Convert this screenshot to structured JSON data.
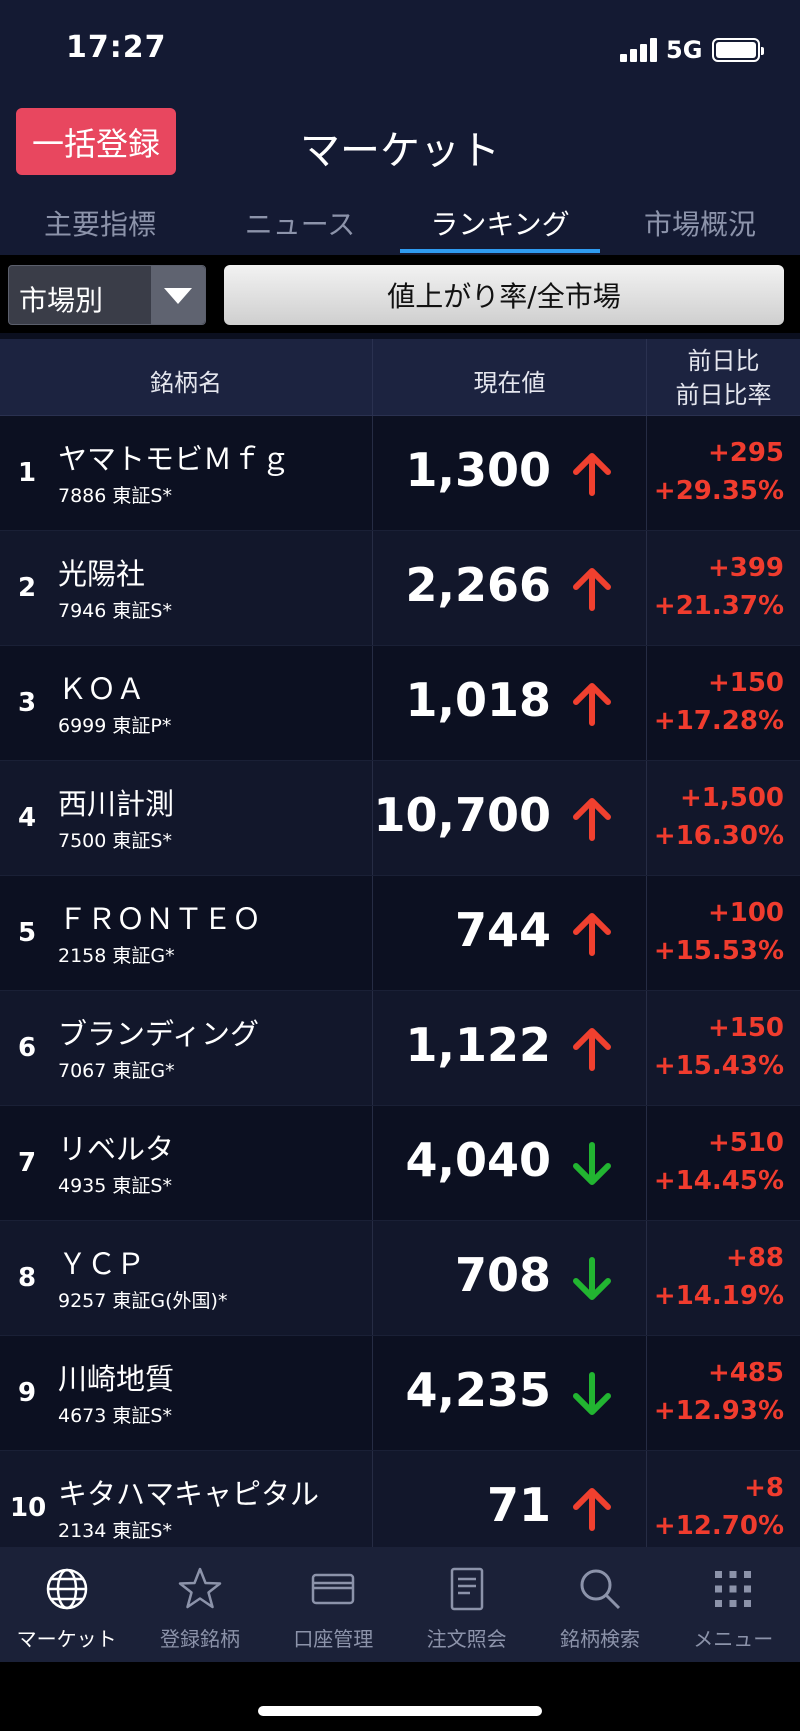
{
  "status_bar": {
    "time": "17:27",
    "network": "5G"
  },
  "header": {
    "bulk_register_label": "一括登録",
    "title": "マーケット",
    "tabs": [
      {
        "label": "主要指標",
        "active": false
      },
      {
        "label": "ニュース",
        "active": false
      },
      {
        "label": "ランキング",
        "active": true
      },
      {
        "label": "市場概況",
        "active": false
      }
    ]
  },
  "filter": {
    "market_select_value": "市場別",
    "ranking_type_label": "値上がり率/全市場"
  },
  "table": {
    "columns": {
      "name": "銘柄名",
      "price": "現在値",
      "change_line1": "前日比",
      "change_line2": "前日比率"
    },
    "rows": [
      {
        "rank": "1",
        "name": "ヤマトモビＭｆｇ",
        "code": "7886 東証S*",
        "price": "1,300",
        "direction": "up",
        "change": "+295",
        "change_pct": "+29.35%"
      },
      {
        "rank": "2",
        "name": "光陽社",
        "code": "7946 東証S*",
        "price": "2,266",
        "direction": "up",
        "change": "+399",
        "change_pct": "+21.37%"
      },
      {
        "rank": "3",
        "name": "ＫＯＡ",
        "code": "6999 東証P*",
        "price": "1,018",
        "direction": "up",
        "change": "+150",
        "change_pct": "+17.28%"
      },
      {
        "rank": "4",
        "name": "西川計測",
        "code": "7500 東証S*",
        "price": "10,700",
        "direction": "up",
        "change": "+1,500",
        "change_pct": "+16.30%"
      },
      {
        "rank": "5",
        "name": "ＦＲＯＮＴＥＯ",
        "code": "2158 東証G*",
        "price": "744",
        "direction": "up",
        "change": "+100",
        "change_pct": "+15.53%"
      },
      {
        "rank": "6",
        "name": "ブランディング",
        "code": "7067 東証G*",
        "price": "1,122",
        "direction": "up",
        "change": "+150",
        "change_pct": "+15.43%"
      },
      {
        "rank": "7",
        "name": "リベルタ",
        "code": "4935 東証S*",
        "price": "4,040",
        "direction": "down",
        "change": "+510",
        "change_pct": "+14.45%"
      },
      {
        "rank": "8",
        "name": "ＹＣＰ",
        "code": "9257 東証G(外国)*",
        "price": "708",
        "direction": "down",
        "change": "+88",
        "change_pct": "+14.19%"
      },
      {
        "rank": "9",
        "name": "川崎地質",
        "code": "4673 東証S*",
        "price": "4,235",
        "direction": "down",
        "change": "+485",
        "change_pct": "+12.93%"
      },
      {
        "rank": "10",
        "name": "キタハマキャピタル",
        "code": "2134 東証S*",
        "price": "71",
        "direction": "up",
        "change": "+8",
        "change_pct": "+12.70%"
      }
    ]
  },
  "colors": {
    "up_arrow": "#f0402f",
    "down_arrow": "#22b531",
    "change_text": "#f03c2e",
    "accent_tab": "#2f9bf0",
    "bulk_button": "#e8475f"
  },
  "bottom_nav": [
    {
      "label": "マーケット",
      "icon": "globe-icon",
      "active": true
    },
    {
      "label": "登録銘柄",
      "icon": "star-icon",
      "active": false
    },
    {
      "label": "口座管理",
      "icon": "card-icon",
      "active": false
    },
    {
      "label": "注文照会",
      "icon": "document-icon",
      "active": false
    },
    {
      "label": "銘柄検索",
      "icon": "search-icon",
      "active": false
    },
    {
      "label": "メニュー",
      "icon": "grid-menu-icon",
      "active": false
    }
  ]
}
